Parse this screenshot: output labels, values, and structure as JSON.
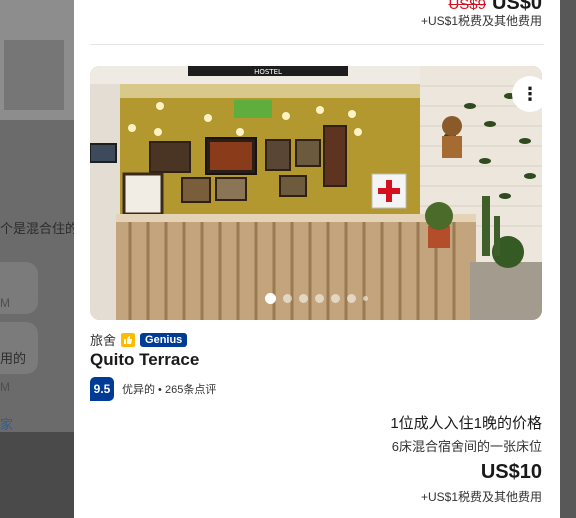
{
  "background": {
    "snippet_main": "个是混合住的",
    "time_1": "M",
    "snippet_used": "用的",
    "time_2": "M",
    "link": "家"
  },
  "previous_listing": {
    "old_price": "US$9",
    "price": "US$0",
    "tax_note": "+US$1税费及其他费用"
  },
  "listing": {
    "photo_sign": "HOSTEL",
    "property_type": "旅舍",
    "genius_label": "Genius",
    "name": "Quito Terrace",
    "score": "9.5",
    "rating_summary": "优异的 • 265条点评",
    "photo_count_dots": 7,
    "active_dot_index": 0,
    "price_heading": "1位成人入住1晚的价格",
    "bed_info": "6床混合宿舍间的一张床位",
    "price": "US$10",
    "tax_note": "+US$1税费及其他费用"
  },
  "icons": {
    "more": "more-vertical-icon",
    "thumb": "thumbs-up-icon"
  },
  "colors": {
    "genius_blue": "#003b95",
    "score_blue": "#003b95",
    "thumb_yellow": "#febb02",
    "old_price_red": "#d4111e"
  }
}
